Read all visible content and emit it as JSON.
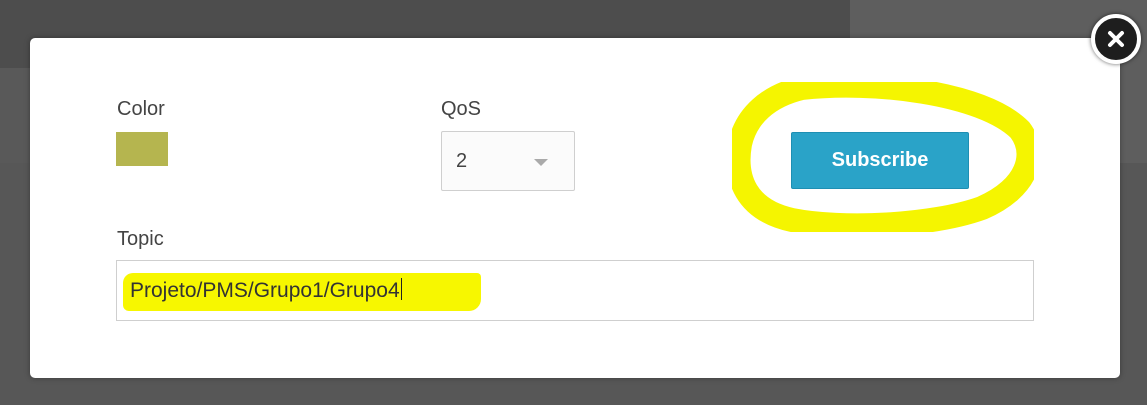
{
  "modal": {
    "color_label": "Color",
    "color_value": "#b5b54f",
    "qos_label": "QoS",
    "qos_value": "2",
    "subscribe_label": "Subscribe",
    "topic_label": "Topic",
    "topic_value": "Projeto/PMS/Grupo1/Grupo4",
    "close_icon": "close-icon"
  },
  "colors": {
    "accent": "#2aa3c8",
    "highlight": "#f7f700"
  }
}
